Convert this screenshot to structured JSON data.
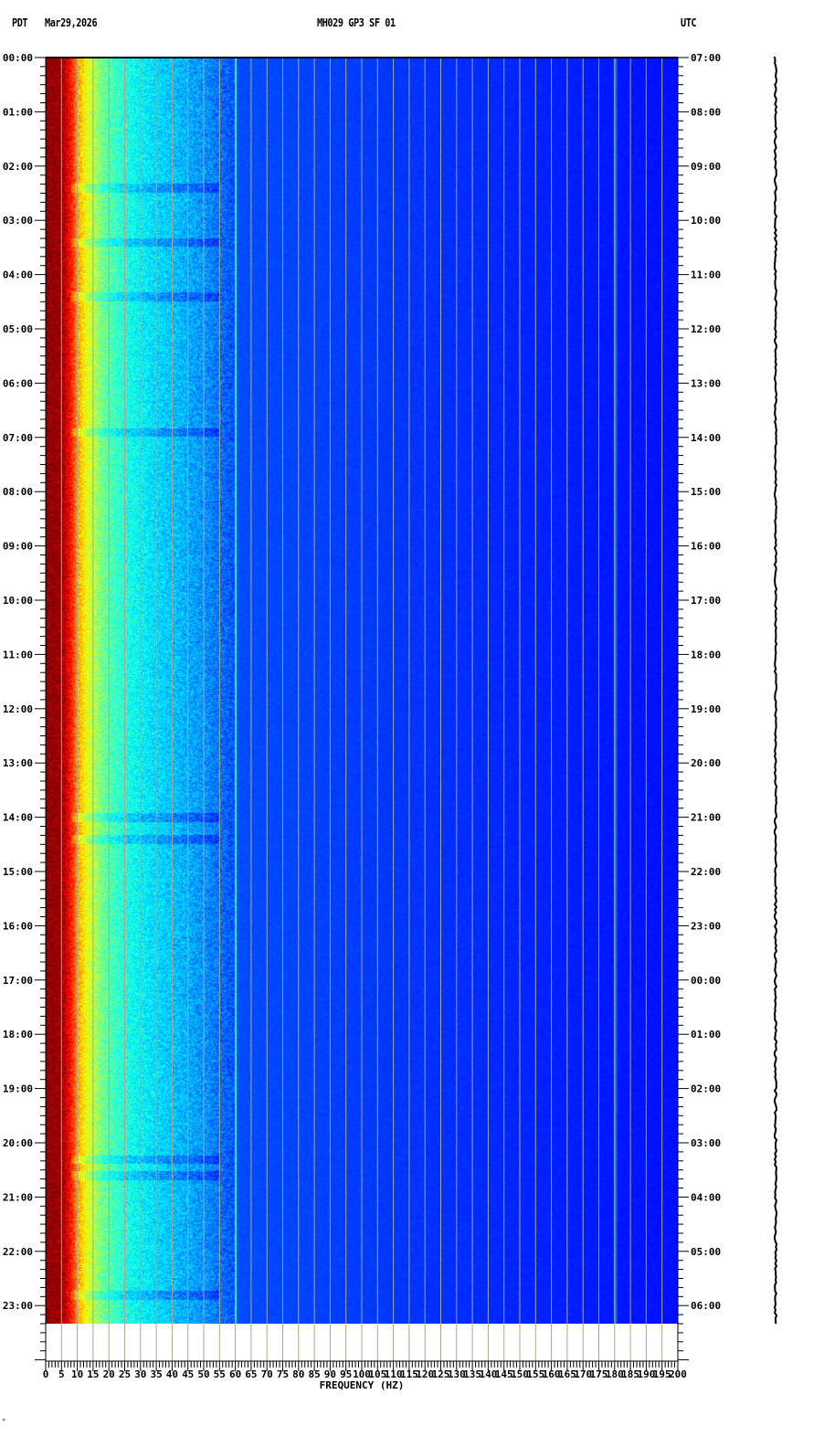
{
  "header": {
    "left_timezone": "PDT",
    "date": "Mar29,2026",
    "station": "MH029 GP3 SF 01",
    "right_timezone": "UTC"
  },
  "footer_mark": "ᴹ",
  "chart_data": {
    "type": "heatmap",
    "title": "MH029 GP3 SF 01",
    "xlabel": "FREQUENCY (HZ)",
    "ylabel": "",
    "xlim": [
      0,
      200
    ],
    "x_ticks": [
      0,
      5,
      10,
      15,
      20,
      25,
      30,
      35,
      40,
      45,
      50,
      55,
      60,
      65,
      70,
      75,
      80,
      85,
      90,
      95,
      100,
      105,
      110,
      115,
      120,
      125,
      130,
      135,
      140,
      145,
      150,
      155,
      160,
      165,
      170,
      175,
      180,
      185,
      190,
      195,
      200
    ],
    "ylim_hours": [
      0,
      24
    ],
    "data_end_hour": 23.33,
    "left_time_labels": [
      "00:00",
      "01:00",
      "02:00",
      "03:00",
      "04:00",
      "05:00",
      "06:00",
      "07:00",
      "08:00",
      "09:00",
      "10:00",
      "11:00",
      "12:00",
      "13:00",
      "14:00",
      "15:00",
      "16:00",
      "17:00",
      "18:00",
      "19:00",
      "20:00",
      "21:00",
      "22:00",
      "23:00"
    ],
    "right_time_labels": [
      "07:00",
      "08:00",
      "09:00",
      "10:00",
      "11:00",
      "12:00",
      "13:00",
      "14:00",
      "15:00",
      "16:00",
      "17:00",
      "18:00",
      "19:00",
      "20:00",
      "21:00",
      "22:00",
      "23:00",
      "00:00",
      "01:00",
      "02:00",
      "03:00",
      "04:00",
      "05:00",
      "06:00"
    ],
    "colormap": "jet",
    "spectral_profile": {
      "freq_hz": [
        0,
        5,
        8,
        10,
        13,
        18,
        25,
        35,
        50,
        60,
        200
      ],
      "level": [
        1.0,
        0.98,
        0.85,
        0.72,
        0.6,
        0.48,
        0.4,
        0.34,
        0.27,
        0.2,
        0.14
      ]
    },
    "narrowband_lines_hz": [
      60,
      180
    ],
    "quiet_bands_hours": [
      2.4,
      3.4,
      4.4,
      6.9,
      14.0,
      14.4,
      20.3,
      20.6,
      22.8
    ],
    "colors": {
      "grid": "#a8a890",
      "background": "#ffffff"
    }
  }
}
